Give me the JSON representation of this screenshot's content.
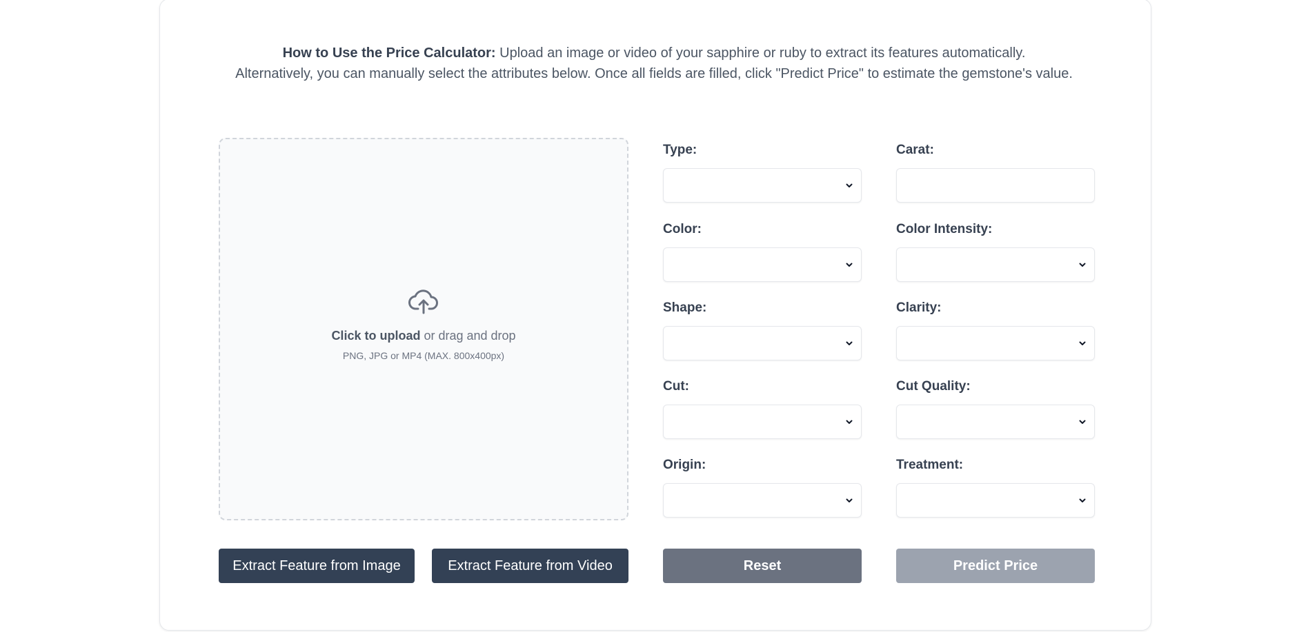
{
  "instructions": {
    "lead": "How to Use the Price Calculator:",
    "line1_rest": " Upload an image or video of your sapphire or ruby to extract its features automatically.",
    "line2": "Alternatively, you can manually select the attributes below. Once all fields are filled, click \"Predict Price\" to estimate the gemstone's value."
  },
  "upload": {
    "icon": "cloud-upload-icon",
    "click_text": "Click to upload",
    "drag_text": " or drag and drop",
    "hint": "PNG, JPG or MP4 (MAX. 800x400px)"
  },
  "form": {
    "type_label": "Type:",
    "type_value": "",
    "carat_label": "Carat:",
    "carat_value": "",
    "color_label": "Color:",
    "color_value": "",
    "color_intensity_label": "Color Intensity:",
    "color_intensity_value": "",
    "shape_label": "Shape:",
    "shape_value": "",
    "clarity_label": "Clarity:",
    "clarity_value": "",
    "cut_label": "Cut:",
    "cut_value": "",
    "cut_quality_label": "Cut Quality:",
    "cut_quality_value": "",
    "origin_label": "Origin:",
    "origin_value": "",
    "treatment_label": "Treatment:",
    "treatment_value": ""
  },
  "buttons": {
    "extract_image": "Extract Feature from Image",
    "extract_video": "Extract Feature from Video",
    "reset": "Reset",
    "predict": "Predict Price"
  },
  "colors": {
    "dark_button": "#334155",
    "reset_button": "#6b7280",
    "predict_button_disabled": "#9ca3af",
    "upload_zone_bg": "#f9fafb"
  }
}
